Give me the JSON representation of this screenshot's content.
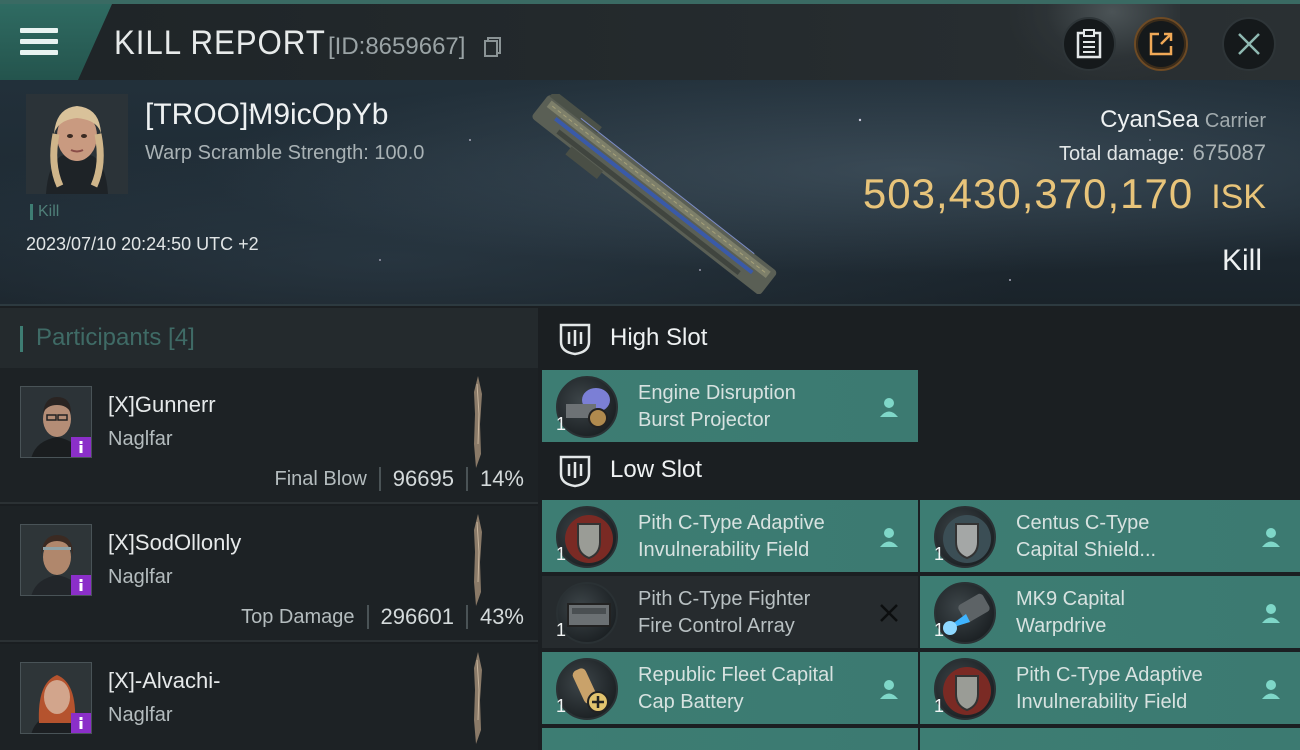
{
  "header": {
    "title": "KILL REPORT",
    "report_id": "[ID:8659667]",
    "icons": [
      "menu-icon",
      "copy-icon",
      "clipboard-icon",
      "share-icon",
      "close-icon"
    ]
  },
  "pilot": {
    "name": "[TROO]M9icOpYb",
    "warp_scramble": "Warp Scramble Strength: 100.0",
    "tag": "Kill",
    "timestamp": "2023/07/10 20:24:50 UTC +2"
  },
  "victim": {
    "ship": "CyanSea",
    "ship_class": "Carrier",
    "total_damage_label": "Total damage:",
    "total_damage_value": "675087",
    "isk_value": "503,430,370,170",
    "isk_currency": "ISK",
    "result": "Kill"
  },
  "participants": {
    "header": "Participants [4]",
    "rows": [
      {
        "name": "[X]Gunnerr",
        "ship": "Naglfar",
        "stat_label": "Final Blow",
        "damage": "96695",
        "percent": "14%"
      },
      {
        "name": "[X]SodOllonly",
        "ship": "Naglfar",
        "stat_label": "Top Damage",
        "damage": "296601",
        "percent": "43%"
      },
      {
        "name": "[X]-Alvachi-",
        "ship": "Naglfar",
        "stat_label": "",
        "damage": "",
        "percent": ""
      }
    ]
  },
  "slots": {
    "high": {
      "title": "High Slot",
      "items": [
        {
          "line1": "Engine Disruption",
          "line2": "Burst Projector",
          "qty": "1",
          "status": "person-icon"
        }
      ]
    },
    "low": {
      "title": "Low Slot",
      "items": [
        {
          "line1": "Pith C-Type Adaptive",
          "line2": "Invulnerability Field",
          "qty": "1",
          "status": "person-icon"
        },
        {
          "line1": "Centus C-Type",
          "line2": "Capital Shield...",
          "qty": "1",
          "status": "person-icon"
        },
        {
          "line1": "Pith C-Type Fighter",
          "line2": "Fire Control Array",
          "qty": "1",
          "status": "destroyed-x-icon"
        },
        {
          "line1": "MK9 Capital",
          "line2": "Warpdrive",
          "qty": "1",
          "status": "person-icon"
        },
        {
          "line1": "Republic Fleet Capital",
          "line2": "Cap Battery",
          "qty": "1",
          "status": "person-icon"
        },
        {
          "line1": "Pith C-Type Adaptive",
          "line2": "Invulnerability Field",
          "qty": "1",
          "status": "person-icon"
        }
      ]
    }
  },
  "colors": {
    "accent_teal": "#3d7d73",
    "isk_gold": "#e8c47a",
    "badge_purple": "#8b2fc9"
  }
}
